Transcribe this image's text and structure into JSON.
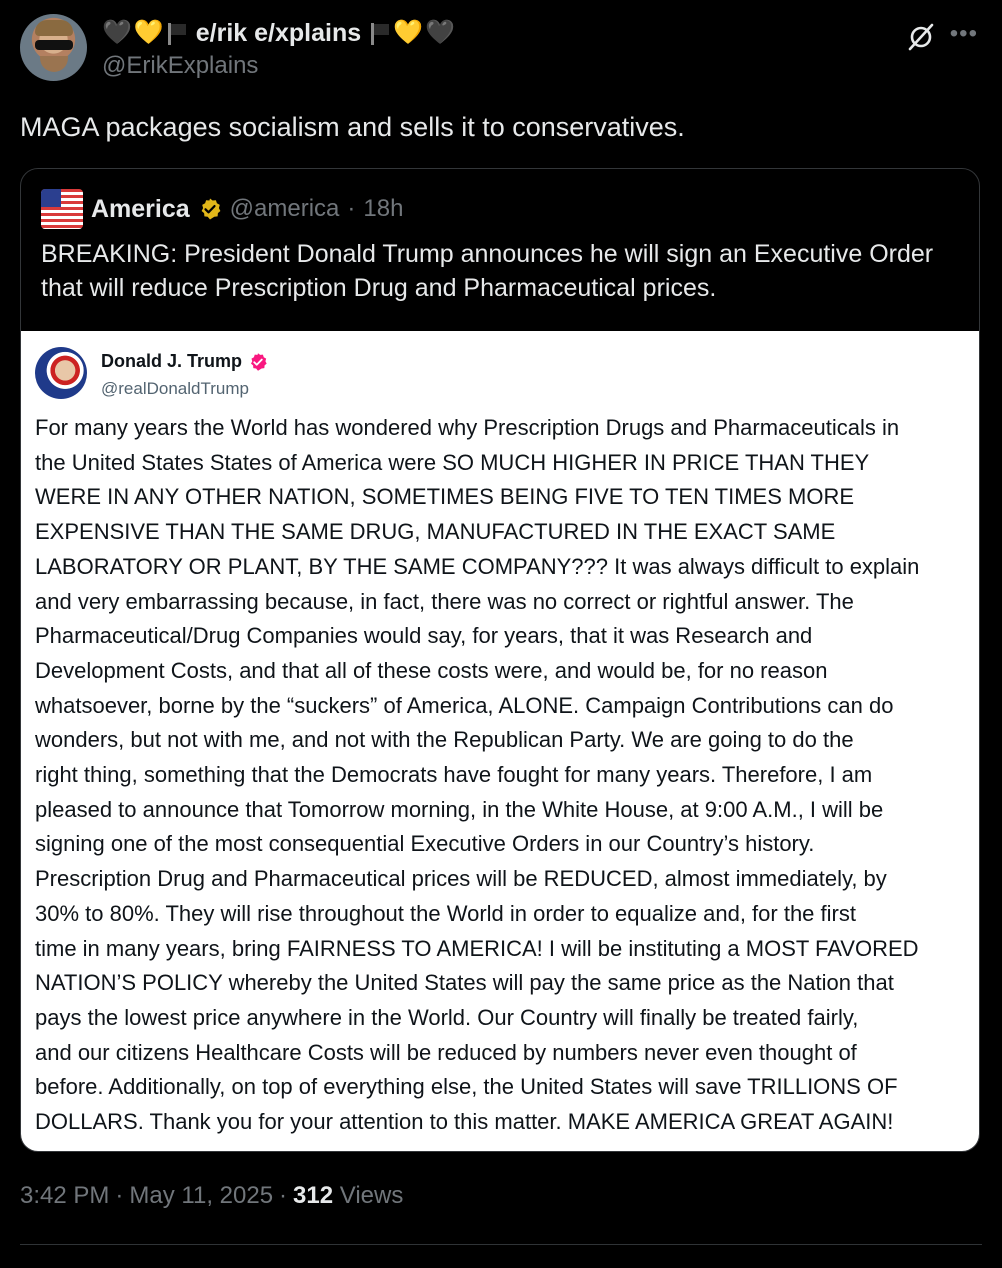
{
  "author": {
    "name_prefix_emojis": [
      "🖤",
      "💛"
    ],
    "display_name": "e/rik e/xplains",
    "name_suffix_emojis": [
      "💛",
      "🖤"
    ],
    "handle": "@ErikExplains"
  },
  "tweet": {
    "text": "MAGA packages socialism and sells it to conservatives."
  },
  "quoted": {
    "name": "America",
    "handle": "@america",
    "separator": "·",
    "time": "18h",
    "text": "BREAKING: President Donald Trump announces he will sign an Executive Order that will reduce Prescription Drug and Pharmaceutical prices.",
    "media": {
      "name": "Donald J. Trump",
      "handle": "@realDonaldTrump",
      "body": "For many years the World has wondered why Prescription Drugs and Pharmaceuticals in\nthe United States States of America were SO MUCH HIGHER IN PRICE THAN THEY\nWERE IN ANY OTHER NATION, SOMETIMES BEING FIVE TO TEN TIMES MORE\nEXPENSIVE THAN THE SAME DRUG, MANUFACTURED IN THE EXACT SAME\nLABORATORY OR PLANT, BY THE SAME COMPANY??? It was always difficult to explain\nand very embarrassing because, in fact, there was no correct or rightful answer. The\nPharmaceutical/Drug Companies would say, for years, that it was Research and\nDevelopment Costs, and that all of these costs were, and would be, for no reason\nwhatsoever, borne by the “suckers” of America, ALONE. Campaign Contributions can do\nwonders, but not with me, and not with the Republican Party. We are going to do the\nright thing, something that the Democrats have fought for many years. Therefore, I am\npleased to announce that Tomorrow morning, in the White House, at 9:00 A.M., I will be\nsigning one of the most consequential Executive Orders in our Country’s history.\nPrescription Drug and Pharmaceutical prices will be REDUCED, almost immediately, by\n30% to 80%. They will rise throughout the World in order to equalize and, for the first\ntime in many years, bring FAIRNESS TO AMERICA! I will be instituting a MOST FAVORED\nNATION’S POLICY whereby the United States will pay the same price as the Nation that\npays the lowest price anywhere in the World. Our Country will finally be treated fairly,\nand our citizens Healthcare Costs will be reduced by numbers never even thought of\nbefore. Additionally, on top of everything else, the United States will save TRILLIONS OF\nDOLLARS. Thank you for your attention to this matter. MAKE AMERICA GREAT AGAIN!"
    }
  },
  "meta": {
    "time": "3:42 PM",
    "sep1": "·",
    "date": "May 11, 2025",
    "sep2": "·",
    "views_count": "312",
    "views_label": "Views"
  },
  "icons": {
    "grok": "grok-icon",
    "more": "more-icon",
    "verified_gold": "verified-gold-badge-icon",
    "verified_red": "verified-red-badge-icon",
    "flag": "flag-icon"
  },
  "colors": {
    "background": "#000000",
    "text_primary": "#e7e9ea",
    "text_secondary": "#71767b",
    "verified_gold": "#e2b719",
    "verified_red": "#f91880"
  }
}
